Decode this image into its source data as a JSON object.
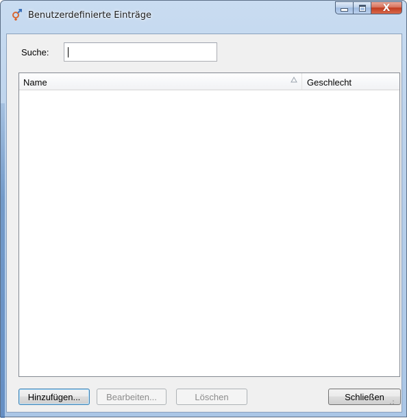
{
  "window": {
    "title": "Benutzerdefinierte Einträge",
    "icon": "gender-icon",
    "controls": [
      "minimize-icon",
      "maximize-icon",
      "close-icon"
    ],
    "close_glyph": "X"
  },
  "search": {
    "label": "Suche:",
    "value": "",
    "placeholder": ""
  },
  "list": {
    "columns": [
      {
        "label": "Name",
        "sort": "ascending"
      },
      {
        "label": "Geschlecht"
      }
    ],
    "rows": []
  },
  "buttons": {
    "add": "Hinzufügen...",
    "edit": "Bearbeiten...",
    "delete": "Löschen",
    "close": "Schließen"
  },
  "colors": {
    "close_button": "#c13b1f",
    "frame": "#b9d0ea",
    "icon_accent": "#d9662f"
  }
}
